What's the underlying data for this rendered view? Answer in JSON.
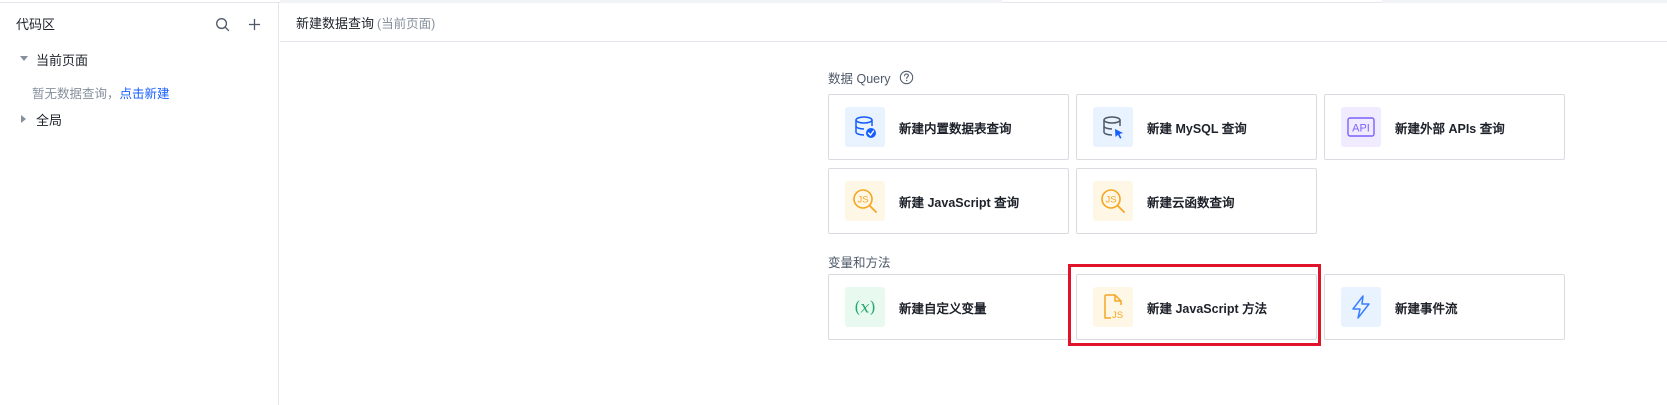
{
  "sidebar": {
    "title": "代码区",
    "tree": {
      "current_page": "当前页面",
      "empty_hint": "暂无数据查询，",
      "empty_link": "点击新建",
      "global": "全局"
    }
  },
  "main": {
    "title": "新建数据查询",
    "subtitle": "(当前页面)"
  },
  "sections": {
    "query_label": "数据 Query",
    "vars_label": "变量和方法"
  },
  "cards": {
    "builtin_table": "新建内置数据表查询",
    "mysql": "新建 MySQL 查询",
    "external_api": "新建外部 APIs 查询",
    "js_query": "新建 JavaScript 查询",
    "cloud_function": "新建云函数查询",
    "custom_variable": "新建自定义变量",
    "js_method": "新建 JavaScript 方法",
    "event_flow": "新建事件流"
  },
  "icons": {
    "builtin_table": "database-icon",
    "mysql": "mysql-database-icon",
    "external_api": "api-icon",
    "js_query": "javascript-search-icon",
    "cloud_function": "cloud-function-icon",
    "custom_variable": "variable-x-icon",
    "js_method": "javascript-file-icon",
    "event_flow": "lightning-icon",
    "API_text": "API",
    "JS_text": "JS",
    "X_text": "(𝑥)"
  },
  "colors": {
    "accent_blue": "#165dff",
    "highlight_red": "#e0132b",
    "orange": "#f5a623",
    "purple": "#7b61ff",
    "green": "#23a86b"
  }
}
